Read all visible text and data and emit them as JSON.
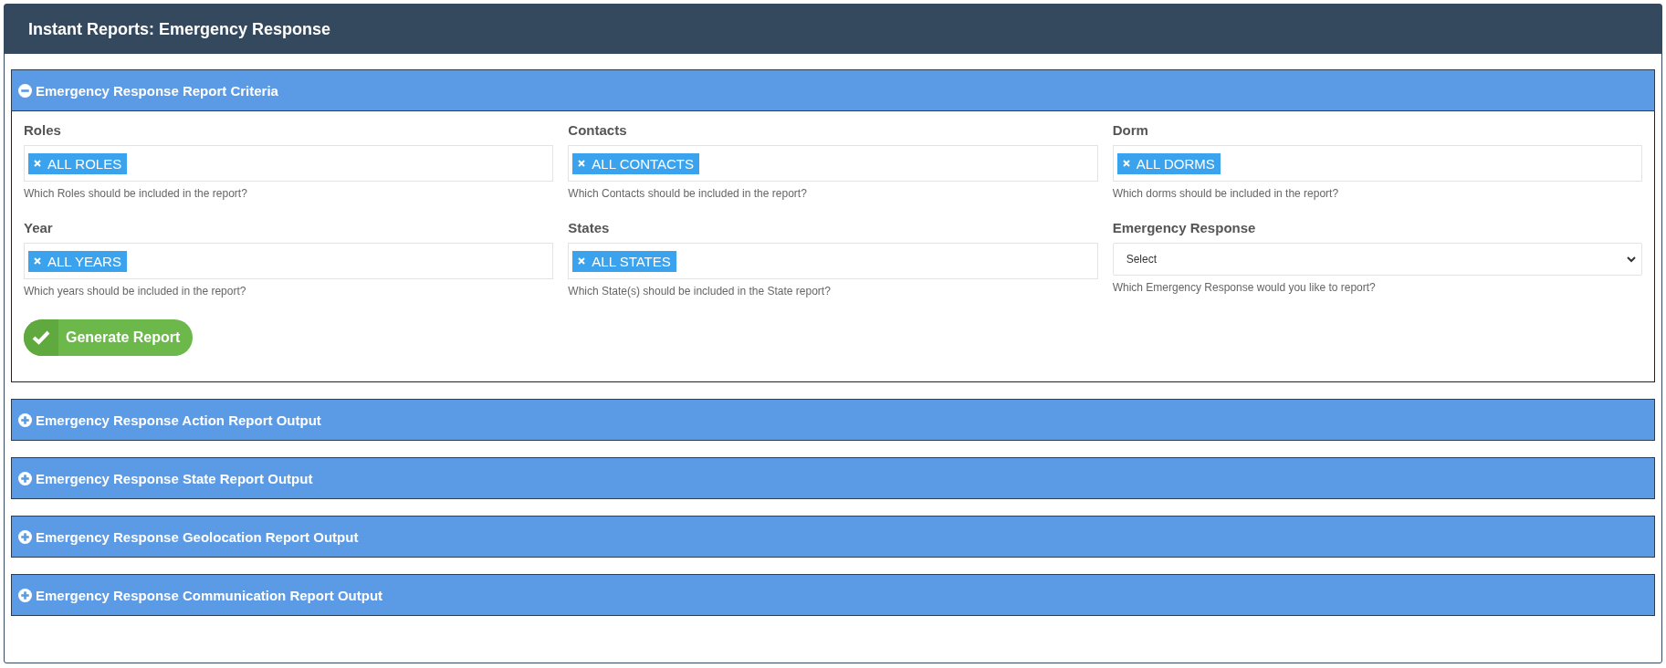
{
  "window": {
    "title": "Instant Reports: Emergency Response"
  },
  "sections": [
    {
      "title": "Emergency Response Report Criteria",
      "expanded": true,
      "fields": [
        {
          "kind": "tags",
          "label": "Roles",
          "tags": [
            "ALL ROLES"
          ],
          "help": "Which Roles should be included in the report?"
        },
        {
          "kind": "tags",
          "label": "Contacts",
          "tags": [
            "ALL CONTACTS"
          ],
          "help": "Which Contacts should be included in the report?"
        },
        {
          "kind": "tags",
          "label": "Dorm",
          "tags": [
            "ALL DORMS"
          ],
          "help": "Which dorms should be included in the report?"
        },
        {
          "kind": "tags",
          "label": "Year",
          "tags": [
            "ALL YEARS"
          ],
          "help": "Which years should be included in the report?"
        },
        {
          "kind": "tags",
          "label": "States",
          "tags": [
            "ALL STATES"
          ],
          "help": "Which State(s) should be included in the State report?"
        },
        {
          "kind": "select",
          "label": "Emergency Response",
          "value": "Select",
          "help": "Which Emergency Response would you like to report?"
        }
      ],
      "button": "Generate Report"
    },
    {
      "title": "Emergency Response Action Report Output",
      "expanded": false
    },
    {
      "title": "Emergency Response State Report Output",
      "expanded": false
    },
    {
      "title": "Emergency Response Geolocation Report Output",
      "expanded": false
    },
    {
      "title": "Emergency Response Communication Report Output",
      "expanded": false
    }
  ]
}
